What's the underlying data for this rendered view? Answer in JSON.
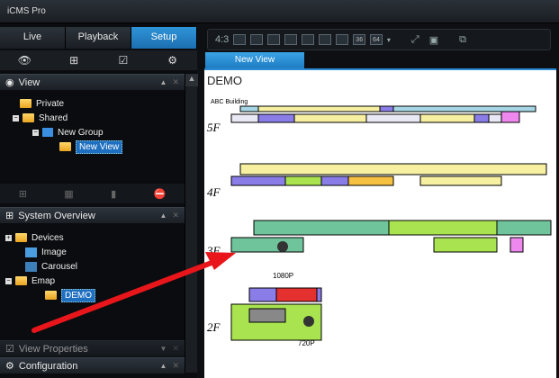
{
  "app": {
    "title": "iCMS Pro"
  },
  "tabs": [
    "Live",
    "Playback",
    "Setup"
  ],
  "view_panel": {
    "title": "View"
  },
  "view_tree": {
    "private": "Private",
    "shared": "Shared",
    "group": "New Group",
    "view": "New View"
  },
  "system_overview": {
    "title": "System Overview"
  },
  "system_tree": {
    "devices": "Devices",
    "image": "Image",
    "carousel": "Carousel",
    "emap": "Emap",
    "demo": "DEMO"
  },
  "view_properties": {
    "title": "View Properties"
  },
  "configuration": {
    "title": "Configuration"
  },
  "toolbar": {
    "ratio": "4:3",
    "n36": "36",
    "n64": "64"
  },
  "main": {
    "view_tab": "New View",
    "map_title": "DEMO"
  },
  "map": {
    "building": "ABC Building",
    "floors": [
      "5F",
      "4F",
      "3F",
      "2F"
    ],
    "cam1": "1080P",
    "cam2": "720P"
  },
  "colors": {
    "accent": "#1f7dc2",
    "arrow": "#e8161b"
  }
}
